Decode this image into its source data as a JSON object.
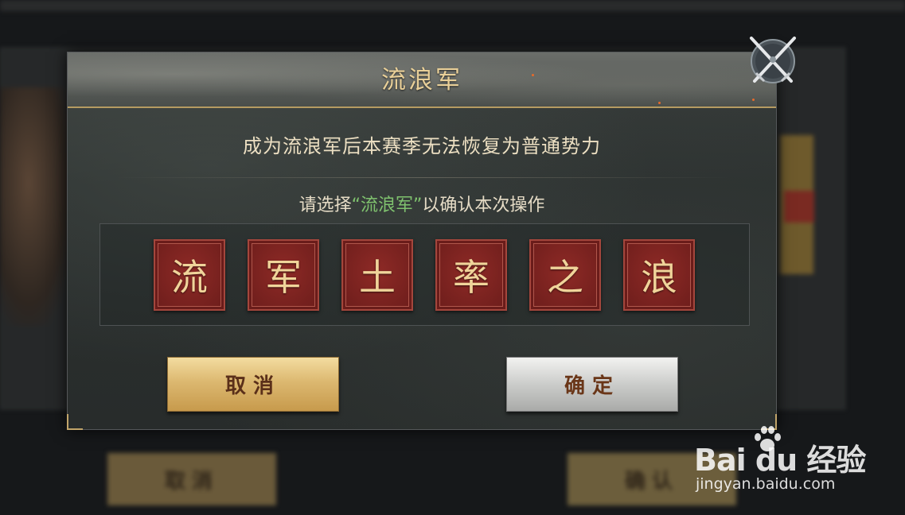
{
  "background": {
    "buttons": [
      {
        "label": "取消"
      },
      {
        "label": "确认"
      }
    ]
  },
  "dialog": {
    "title": "流浪军",
    "warning": "成为流浪军后本赛季无法恢复为普通势力",
    "instruction": {
      "prefix": "请选择",
      "highlight": "“流浪军”",
      "suffix": "以确认本次操作"
    },
    "characters": [
      "流",
      "军",
      "土",
      "率",
      "之",
      "浪"
    ],
    "cancel_label": "取消",
    "confirm_label": "确定",
    "close_icon": "crossed-swords-close-icon"
  },
  "colors": {
    "title": "#e8cf98",
    "highlight": "#7fc26e",
    "tile": "#8e2a26",
    "cancel_button": "#dcb870",
    "confirm_button": "#cfd0ce"
  },
  "watermark": {
    "brand": "Bai du 经验",
    "url": "jingyan.baidu.com"
  }
}
